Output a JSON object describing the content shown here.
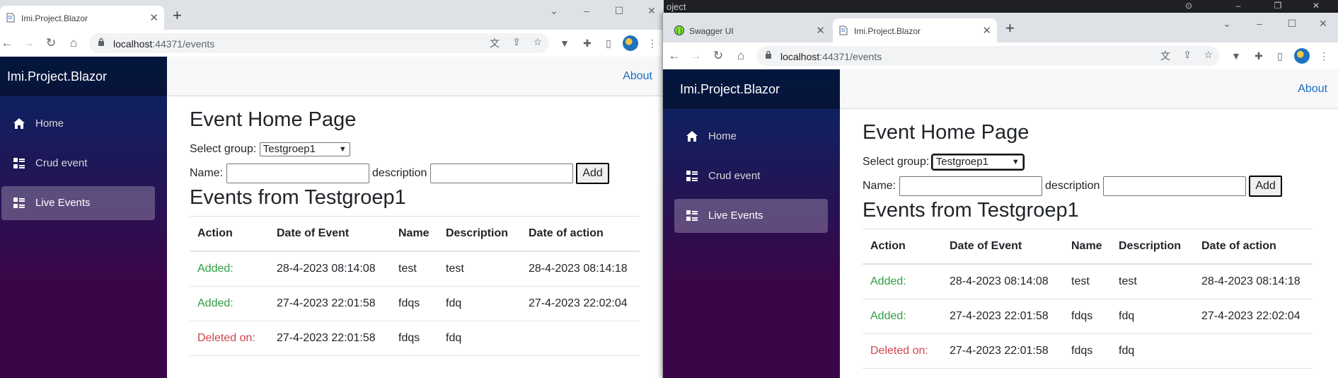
{
  "background_window": {
    "title_fragment": "oject"
  },
  "left_window": {
    "tabs": [
      {
        "title": "Imi.Project.Blazor",
        "active": true
      }
    ],
    "url_host": "localhost",
    "url_rest": ":44371/events"
  },
  "right_window": {
    "tabs": [
      {
        "title": "Swagger UI",
        "active": false
      },
      {
        "title": "Imi.Project.Blazor",
        "active": true
      }
    ],
    "url_host": "localhost",
    "url_rest": ":44371/events"
  },
  "app": {
    "brand": "Imi.Project.Blazor",
    "about": "About",
    "nav": [
      {
        "label": "Home",
        "icon": "home-icon"
      },
      {
        "label": "Crud event",
        "icon": "list-rich-icon"
      },
      {
        "label": "Live Events",
        "icon": "list-rich-icon",
        "active": true
      }
    ],
    "page_title": "Event Home Page",
    "select_group_label": "Select group:",
    "selected_group": "Testgroep1",
    "name_label": "Name:",
    "description_label": "description",
    "add_label": "Add",
    "events_heading": "Events from Testgroep1",
    "table": {
      "headers": [
        "Action",
        "Date of Event",
        "Name",
        "Description",
        "Date of action"
      ],
      "rows": [
        {
          "action": "Added:",
          "status": "added",
          "date_event": "28-4-2023 08:14:08",
          "name": "test",
          "description": "test",
          "date_action": "28-4-2023 08:14:18"
        },
        {
          "action": "Added:",
          "status": "added",
          "date_event": "27-4-2023 22:01:58",
          "name": "fdqs",
          "description": "fdq",
          "date_action": "27-4-2023 22:02:04"
        },
        {
          "action": "Deleted on:",
          "status": "deleted",
          "date_event": "27-4-2023 22:01:58",
          "name": "fdqs",
          "description": "fdq",
          "date_action": ""
        }
      ]
    }
  },
  "colors": {
    "added": "#2f9e44",
    "deleted": "#d0444e",
    "link": "#1b6ec2"
  }
}
